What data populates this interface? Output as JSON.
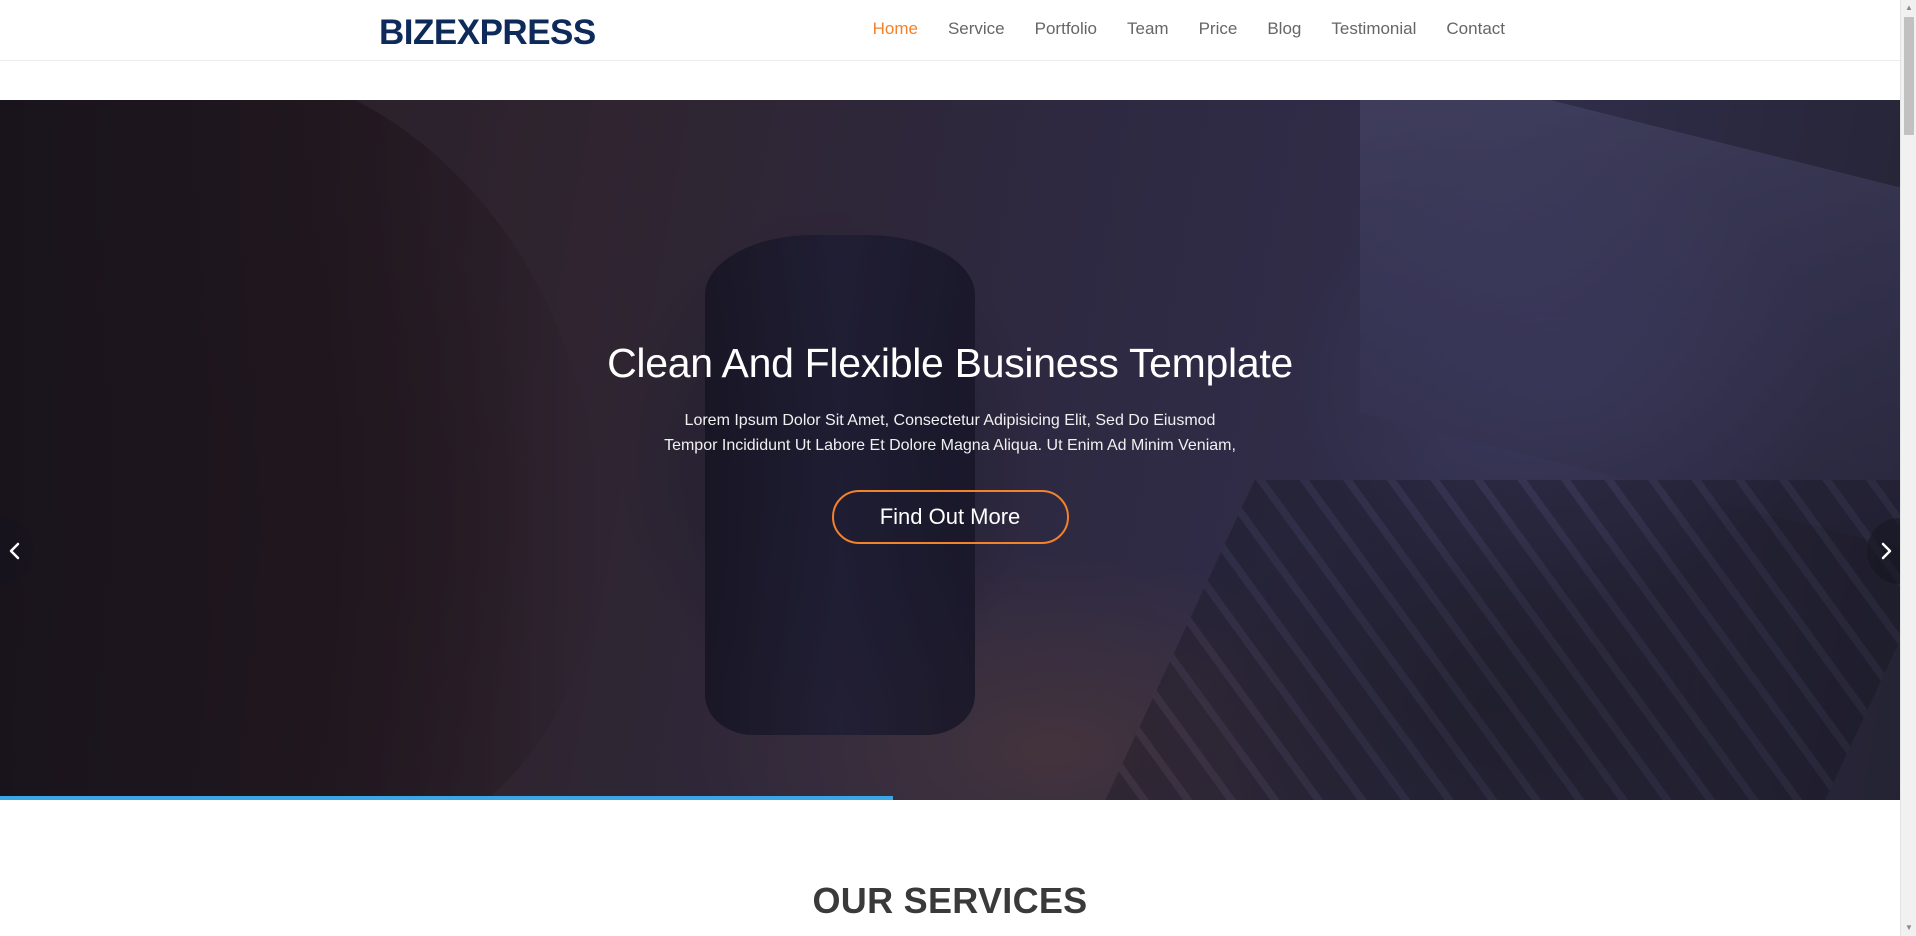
{
  "header": {
    "logo": "BIZEXPRESS",
    "nav": [
      {
        "label": "Home",
        "active": true
      },
      {
        "label": "Service",
        "active": false
      },
      {
        "label": "Portfolio",
        "active": false
      },
      {
        "label": "Team",
        "active": false
      },
      {
        "label": "Price",
        "active": false
      },
      {
        "label": "Blog",
        "active": false
      },
      {
        "label": "Testimonial",
        "active": false
      },
      {
        "label": "Contact",
        "active": false
      }
    ]
  },
  "hero": {
    "title": "Clean And Flexible Business Template",
    "subtitle_line1": "Lorem Ipsum Dolor Sit Amet, Consectetur Adipisicing Elit, Sed Do Eiusmod",
    "subtitle_line2": "Tempor Incididunt Ut Labore Et Dolore Magna Aliqua. Ut Enim Ad Minim Veniam,",
    "button_label": "Find Out More",
    "prev_icon": "chevron-left-icon",
    "next_icon": "chevron-right-icon",
    "slide_progress": 0.47
  },
  "services": {
    "title": "OUR SERVICES"
  },
  "colors": {
    "brand": "#0e2a5a",
    "accent": "#f2822c",
    "progress": "#3aa6e6",
    "nav_text": "#666666"
  }
}
